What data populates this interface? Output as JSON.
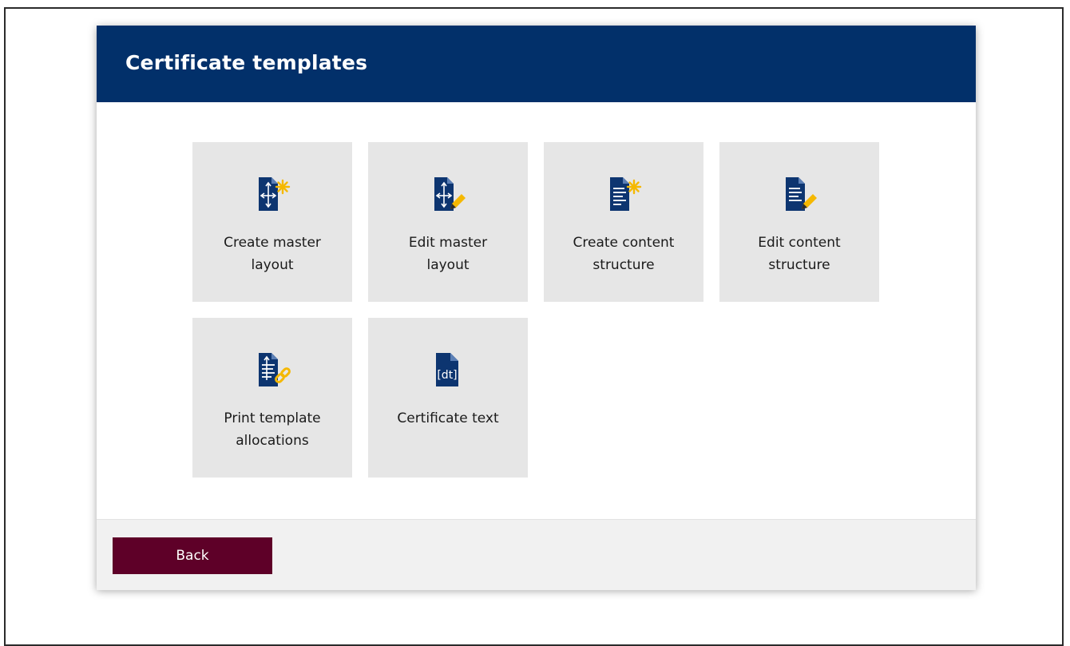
{
  "dialog": {
    "title": "Certificate templates"
  },
  "tiles": [
    {
      "label": "Create master\nlayout",
      "icon": "create-master-layout-icon"
    },
    {
      "label": "Edit master\nlayout",
      "icon": "edit-master-layout-icon"
    },
    {
      "label": "Create content\nstructure",
      "icon": "create-content-structure-icon"
    },
    {
      "label": "Edit content\nstructure",
      "icon": "edit-content-structure-icon"
    },
    {
      "label": "Print template\nallocations",
      "icon": "print-template-allocations-icon"
    },
    {
      "label": "Certificate text",
      "icon": "certificate-text-icon"
    }
  ],
  "footer": {
    "back_label": "Back"
  },
  "icon_glyph_text": "[dt]",
  "colors": {
    "header": "#02306a",
    "tile": "#e6e6e6",
    "back_button": "#5e0028",
    "icon_doc": "#0d3570",
    "icon_accent": "#f5b800"
  }
}
